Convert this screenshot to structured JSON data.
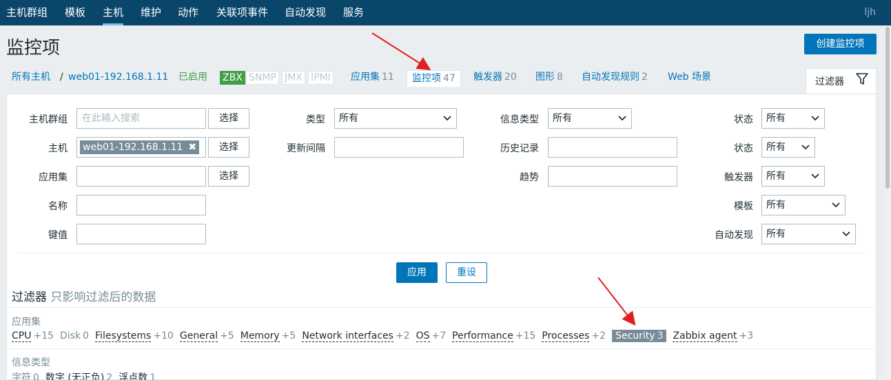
{
  "nav": {
    "items": [
      "主机群组",
      "模板",
      "主机",
      "维护",
      "动作",
      "关联项事件",
      "自动发现",
      "服务"
    ],
    "user": "ljh"
  },
  "header": {
    "title": "监控项",
    "create_label": "创建监控项"
  },
  "breadcrumb": {
    "all_hosts": "所有主机",
    "separator": "/",
    "host": "web01-192.168.1.11",
    "status": "已启用",
    "tags": [
      "ZBX",
      "SNMP",
      "JMX",
      "IPMI"
    ],
    "tabs": [
      {
        "label": "应用集",
        "count": "11"
      },
      {
        "label": "监控项",
        "count": "47"
      },
      {
        "label": "触发器",
        "count": "20"
      },
      {
        "label": "图形",
        "count": "8"
      },
      {
        "label": "自动发现规则",
        "count": "2"
      },
      {
        "label": "Web 场景",
        "count": ""
      }
    ]
  },
  "filter_tab": {
    "label": "过滤器",
    "icon": "funnel-icon"
  },
  "filter": {
    "host_group_label": "主机群组",
    "host_group_placeholder": "在此输入搜索",
    "select_label": "选择",
    "host_label": "主机",
    "host_chip": "web01-192.168.1.11",
    "application_label": "应用集",
    "name_label": "名称",
    "key_label": "键值",
    "type_label": "类型",
    "type_value": "所有",
    "update_interval_label": "更新间隔",
    "info_type_label": "信息类型",
    "info_type_value": "所有",
    "history_label": "历史记录",
    "trends_label": "趋势",
    "state_label": "状态",
    "state_value": "所有",
    "status_label": "状态",
    "status_value": "所有",
    "triggers_label": "触发器",
    "triggers_value": "所有",
    "template_label": "模板",
    "template_value": "所有",
    "discovery_label": "自动发现",
    "discovery_value": "所有",
    "apply_label": "应用",
    "reset_label": "重设"
  },
  "subfilter": {
    "title": "过滤器",
    "hint": "只影响过滤后的数据",
    "applications_label": "应用集",
    "applications": [
      {
        "name": "CPU",
        "count": "+15",
        "active": true,
        "selected": false
      },
      {
        "name": "Disk",
        "count": "0",
        "active": false,
        "selected": false
      },
      {
        "name": "Filesystems",
        "count": "+10",
        "active": true,
        "selected": false
      },
      {
        "name": "General",
        "count": "+5",
        "active": true,
        "selected": false
      },
      {
        "name": "Memory",
        "count": "+5",
        "active": true,
        "selected": false
      },
      {
        "name": "Network interfaces",
        "count": "+2",
        "active": true,
        "selected": false
      },
      {
        "name": "OS",
        "count": "+7",
        "active": true,
        "selected": false
      },
      {
        "name": "Performance",
        "count": "+15",
        "active": true,
        "selected": false
      },
      {
        "name": "Processes",
        "count": "+2",
        "active": true,
        "selected": false
      },
      {
        "name": "Security",
        "count": "3",
        "active": true,
        "selected": true
      },
      {
        "name": "Zabbix agent",
        "count": "+3",
        "active": true,
        "selected": false
      }
    ],
    "info_type_label": "信息类型",
    "info_types": [
      {
        "name": "字符",
        "count": "0",
        "active": false
      },
      {
        "name": "数字 (无正负)",
        "count": "2",
        "active": true
      },
      {
        "name": "浮点数",
        "count": "1",
        "active": true
      }
    ]
  },
  "colors": {
    "nav_bg": "#0a466a",
    "accent": "#0275b8",
    "enabled": "#429e47",
    "arrow": "#e02020"
  }
}
